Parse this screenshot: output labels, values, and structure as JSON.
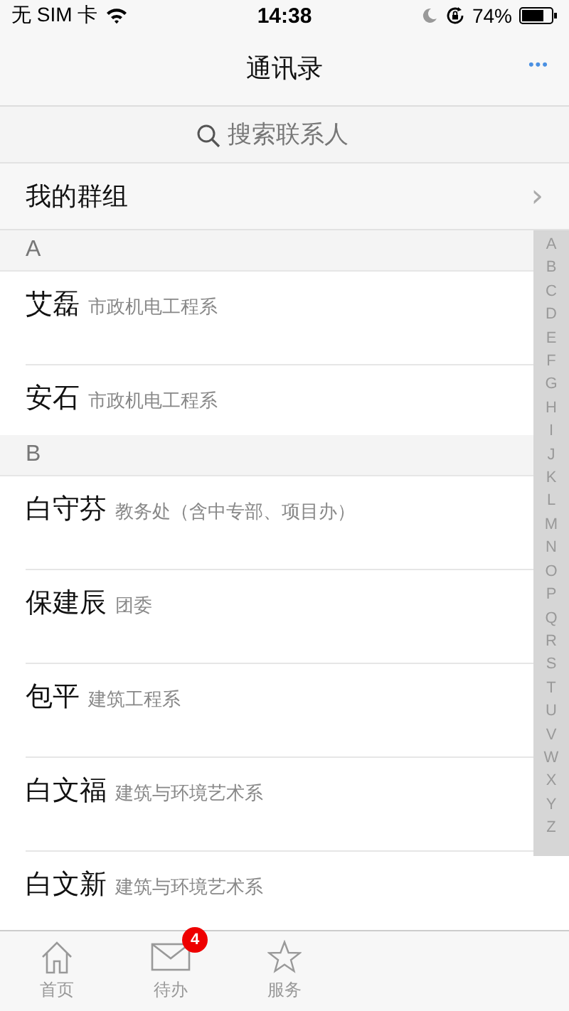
{
  "status_bar": {
    "carrier": "无 SIM 卡",
    "time": "14:38",
    "battery": "74%"
  },
  "nav": {
    "title": "通讯录",
    "more": "•••"
  },
  "search": {
    "placeholder": "搜索联系人"
  },
  "groups_row": {
    "label": "我的群组",
    "chevron": "›"
  },
  "sections": [
    {
      "letter": "A",
      "contacts": [
        {
          "name": "艾磊",
          "department": "市政机电工程系",
          "kind": "phone"
        },
        {
          "name": "安石",
          "department": "市政机电工程系",
          "kind": "plain"
        }
      ]
    },
    {
      "letter": "B",
      "contacts": [
        {
          "name": "白守芬",
          "department": "教务处（含中专部、项目办）",
          "kind": "phone"
        },
        {
          "name": "保建辰",
          "department": "团委",
          "kind": "phone"
        },
        {
          "name": "包平",
          "department": "建筑工程系",
          "kind": "phone"
        },
        {
          "name": "白文福",
          "department": "建筑与环境艺术系",
          "kind": "phone"
        },
        {
          "name": "白文新",
          "department": "建筑与环境艺术系",
          "kind": "plain"
        }
      ]
    }
  ],
  "index": [
    "A",
    "B",
    "C",
    "D",
    "E",
    "F",
    "G",
    "H",
    "I",
    "J",
    "K",
    "L",
    "M",
    "N",
    "O",
    "P",
    "Q",
    "R",
    "S",
    "T",
    "U",
    "V",
    "W",
    "X",
    "Y",
    "Z"
  ],
  "tabs": [
    {
      "label": "首页",
      "kind": "home"
    },
    {
      "label": "待办",
      "kind": "mail",
      "badge": "4"
    },
    {
      "label": "服务",
      "kind": "star"
    }
  ]
}
